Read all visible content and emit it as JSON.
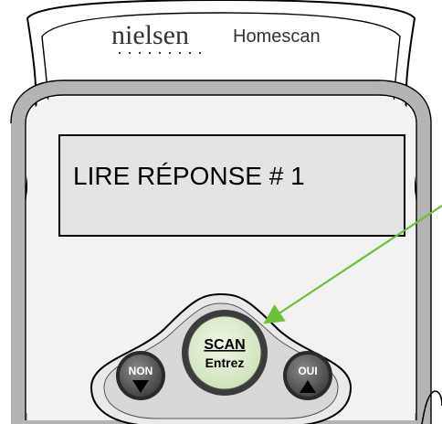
{
  "device": {
    "brand": "nielsen",
    "model": "Homescan"
  },
  "display": {
    "text": "LIRE RÉPONSE # 1"
  },
  "buttons": {
    "scan": {
      "label": "SCAN",
      "sublabel": "Entrez"
    },
    "no": {
      "label": "NON"
    },
    "yes": {
      "label": "OUI"
    }
  },
  "colors": {
    "scan_button": "#d9ecc5",
    "arrow": "#6cbf3c",
    "side_buttons": "#5e5e5e",
    "lcd_background": "#e4e4e4"
  },
  "icons": {
    "no_icon": "triangle-down",
    "yes_icon": "triangle-up"
  }
}
